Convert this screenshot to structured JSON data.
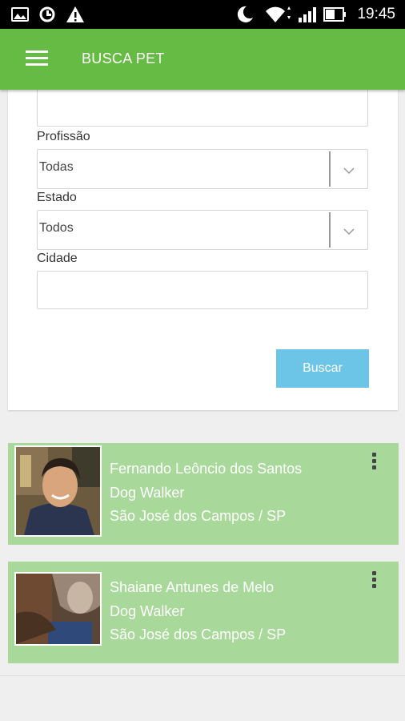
{
  "status_bar": {
    "time": "19:45",
    "icons": [
      "image-icon",
      "sync-icon",
      "warning-icon",
      "moon-icon",
      "wifi-icon",
      "signal-icon",
      "battery-icon"
    ]
  },
  "app_bar": {
    "title": "BUSCA PET",
    "color": "#66bb44"
  },
  "form": {
    "profissao_label": "Profissão",
    "profissao_value": "Todas",
    "estado_label": "Estado",
    "estado_value": "Todos",
    "cidade_label": "Cidade",
    "cidade_value": "",
    "search_label": "Buscar",
    "search_color": "#6cc4e6"
  },
  "results": [
    {
      "name": "Fernando Leôncio dos Santos",
      "profession": "Dog Walker",
      "location": "São José dos Campos / SP"
    },
    {
      "name": "Shaiane Antunes de Melo",
      "profession": "Dog Walker",
      "location": "São José dos Campos / SP"
    }
  ],
  "result_card_color": "#a9d99a"
}
